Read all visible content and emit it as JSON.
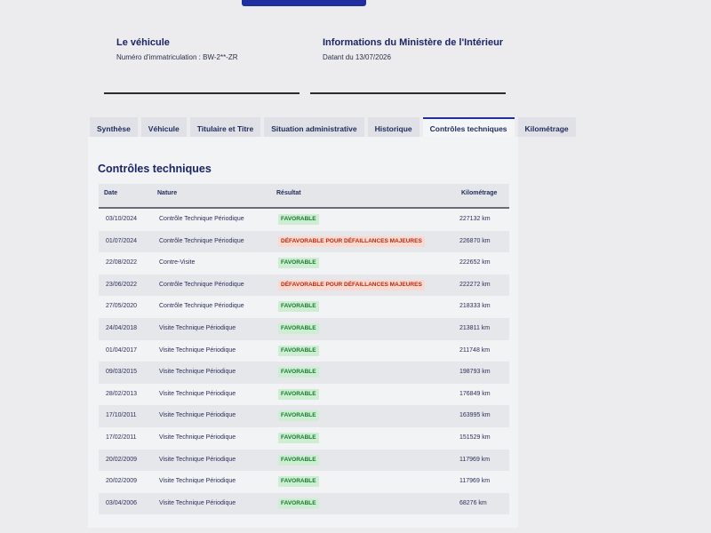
{
  "header": {
    "vehicle_card": {
      "title": "Le véhicule",
      "registration": "Numéro d'immatriculation : BW-2**-ZR"
    },
    "ministry_card": {
      "title": "Informations du Ministère de l'Intérieur",
      "date": "Datant du 13/07/2026"
    }
  },
  "tabs": [
    {
      "label": "Synthèse",
      "active": false
    },
    {
      "label": "Véhicule",
      "active": false
    },
    {
      "label": "Titulaire et Titre",
      "active": false
    },
    {
      "label": "Situation administrative",
      "active": false
    },
    {
      "label": "Historique",
      "active": false
    },
    {
      "label": "Contrôles techniques",
      "active": true
    },
    {
      "label": "Kilométrage",
      "active": false
    }
  ],
  "section_title": "Contrôles techniques",
  "table": {
    "headers": {
      "date": "Date",
      "nature": "Nature",
      "result": "Résultat",
      "mileage": "Kilométrage"
    },
    "rows": [
      {
        "date": "03/10/2024",
        "nature": "Contrôle Technique Périodique",
        "result": "FAVORABLE",
        "status": "ok",
        "mileage": "227132 km"
      },
      {
        "date": "01/07/2024",
        "nature": "Contrôle Technique Périodique",
        "result": "DÉFAVORABLE POUR DÉFAILLANCES MAJEURES",
        "status": "ko",
        "mileage": "226870 km"
      },
      {
        "date": "22/08/2022",
        "nature": "Contre-Visite",
        "result": "FAVORABLE",
        "status": "ok",
        "mileage": "222652 km"
      },
      {
        "date": "23/06/2022",
        "nature": "Contrôle Technique Périodique",
        "result": "DÉFAVORABLE POUR DÉFAILLANCES MAJEURES",
        "status": "ko",
        "mileage": "222272 km"
      },
      {
        "date": "27/05/2020",
        "nature": "Contrôle Technique Périodique",
        "result": "FAVORABLE",
        "status": "ok",
        "mileage": "218333 km"
      },
      {
        "date": "24/04/2018",
        "nature": "Visite Technique Périodique",
        "result": "FAVORABLE",
        "status": "ok",
        "mileage": "213811 km"
      },
      {
        "date": "01/04/2017",
        "nature": "Visite Technique Périodique",
        "result": "FAVORABLE",
        "status": "ok",
        "mileage": "211748 km"
      },
      {
        "date": "09/03/2015",
        "nature": "Visite Technique Périodique",
        "result": "FAVORABLE",
        "status": "ok",
        "mileage": "198793 km"
      },
      {
        "date": "28/02/2013",
        "nature": "Visite Technique Périodique",
        "result": "FAVORABLE",
        "status": "ok",
        "mileage": "176849 km"
      },
      {
        "date": "17/10/2011",
        "nature": "Visite Technique Périodique",
        "result": "FAVORABLE",
        "status": "ok",
        "mileage": "163995 km"
      },
      {
        "date": "17/02/2011",
        "nature": "Visite Technique Périodique",
        "result": "FAVORABLE",
        "status": "ok",
        "mileage": "151529 km"
      },
      {
        "date": "20/02/2009",
        "nature": "Visite Technique Périodique",
        "result": "FAVORABLE",
        "status": "ok",
        "mileage": "117969 km"
      },
      {
        "date": "20/02/2009",
        "nature": "Visite Technique Périodique",
        "result": "FAVORABLE",
        "status": "ok",
        "mileage": "117969 km"
      },
      {
        "date": "03/04/2006",
        "nature": "Visite Technique Périodique",
        "result": "FAVORABLE",
        "status": "ok",
        "mileage": "68276 km"
      }
    ]
  },
  "colors": {
    "accent": "#1f2fa0",
    "ok_bg": "#cdeed3",
    "ok_text": "#167a2c",
    "ko_bg": "#f9d9d0",
    "ko_text": "#b52a0f"
  }
}
